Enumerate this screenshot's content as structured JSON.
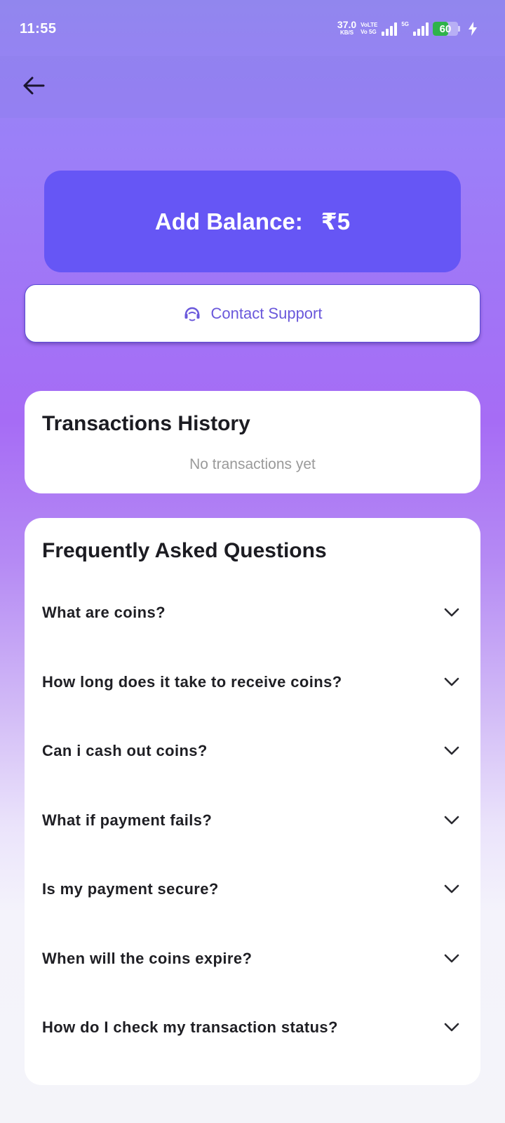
{
  "status_bar": {
    "time": "11:55",
    "net_speed_value": "37.0",
    "net_speed_unit": "KB/S",
    "volte_1": "VoLTE",
    "volte_2": "Vo 5G",
    "five_g": "5G",
    "battery_level": "60",
    "battery_percent": 60
  },
  "header": {
    "back_icon": "arrow-left-icon"
  },
  "balance": {
    "label": "Add Balance:",
    "amount": "₹5"
  },
  "support": {
    "label": "Contact Support",
    "icon": "headset-icon"
  },
  "transactions": {
    "title": "Transactions History",
    "empty_text": "No transactions yet"
  },
  "faq": {
    "title": "Frequently Asked Questions",
    "items": [
      {
        "question": "What are coins?"
      },
      {
        "question": "How long does it take to receive coins?"
      },
      {
        "question": "Can i cash out coins?"
      },
      {
        "question": "What if payment fails?"
      },
      {
        "question": "Is my payment secure?"
      },
      {
        "question": "When will the coins expire?"
      },
      {
        "question": "How do I check my transaction status?"
      }
    ]
  },
  "colors": {
    "accent": "#6656f5",
    "support_text": "#6a58db",
    "battery_green": "#2fb34a"
  }
}
